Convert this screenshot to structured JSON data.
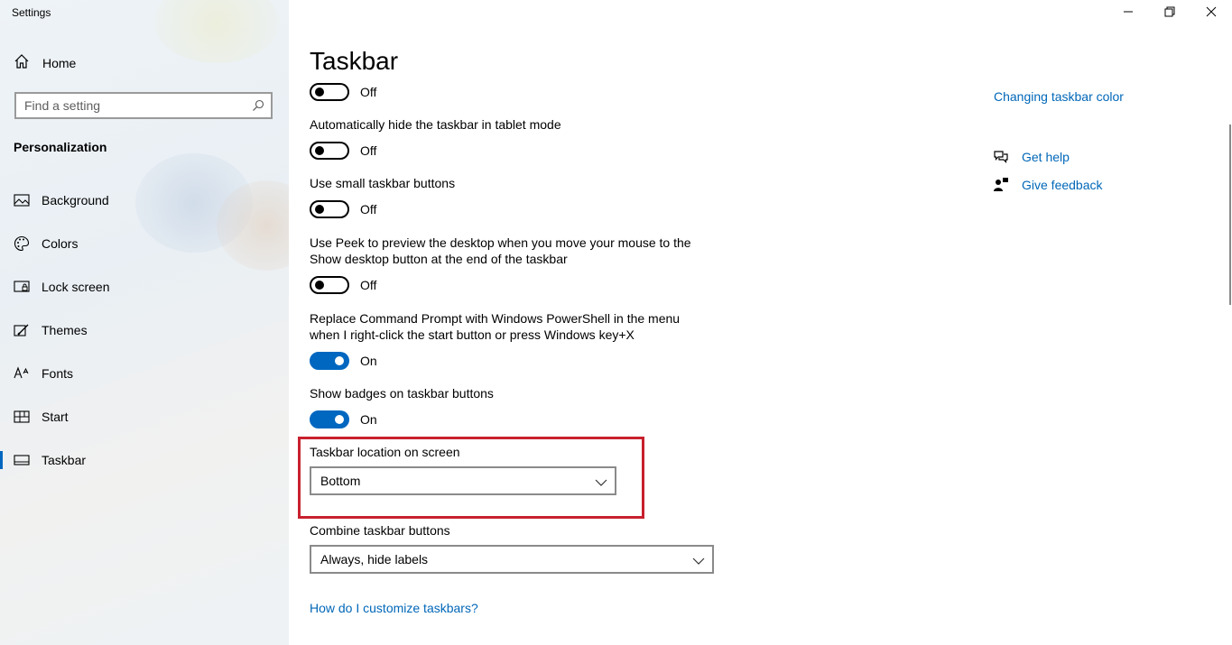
{
  "window": {
    "title": "Settings"
  },
  "sidebar": {
    "home_label": "Home",
    "search_placeholder": "Find a setting",
    "section_title": "Personalization",
    "items": [
      {
        "label": "Background",
        "icon": "image-icon"
      },
      {
        "label": "Colors",
        "icon": "palette-icon"
      },
      {
        "label": "Lock screen",
        "icon": "lock-screen-icon"
      },
      {
        "label": "Themes",
        "icon": "themes-icon"
      },
      {
        "label": "Fonts",
        "icon": "fonts-icon"
      },
      {
        "label": "Start",
        "icon": "start-icon"
      },
      {
        "label": "Taskbar",
        "icon": "taskbar-icon",
        "active": true
      }
    ]
  },
  "main": {
    "title": "Taskbar",
    "settings": [
      {
        "caption": "",
        "state": "Off",
        "on": false
      },
      {
        "caption": "Automatically hide the taskbar in tablet mode",
        "state": "Off",
        "on": false
      },
      {
        "caption": "Use small taskbar buttons",
        "state": "Off",
        "on": false
      },
      {
        "caption": "Use Peek to preview the desktop when you move your mouse to the Show desktop button at the end of the taskbar",
        "state": "Off",
        "on": false
      },
      {
        "caption": "Replace Command Prompt with Windows PowerShell in the menu when I right-click the start button or press Windows key+X",
        "state": "On",
        "on": true
      },
      {
        "caption": "Show badges on taskbar buttons",
        "state": "On",
        "on": true
      }
    ],
    "location": {
      "label": "Taskbar location on screen",
      "value": "Bottom"
    },
    "combine": {
      "label": "Combine taskbar buttons",
      "value": "Always, hide labels"
    },
    "help_link": "How do I customize taskbars?"
  },
  "related": {
    "color_link": "Changing taskbar color",
    "get_help": "Get help",
    "give_feedback": "Give feedback"
  },
  "colors": {
    "accent": "#0067c0",
    "link": "#0067b8",
    "highlight": "#c8202e"
  }
}
